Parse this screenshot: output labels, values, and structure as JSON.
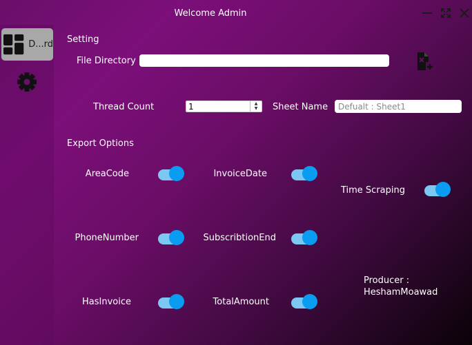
{
  "window": {
    "title": "Welcome Admin"
  },
  "sidebar": {
    "items": [
      {
        "label": "D...rd",
        "icon": "dashboard-icon",
        "active": true
      },
      {
        "label": "",
        "icon": "gear-icon",
        "active": false
      }
    ]
  },
  "settings": {
    "section_title": "Setting",
    "file_directory": {
      "label": "File Directory",
      "value": ""
    },
    "add_file_icon": "add-file-icon",
    "thread_count": {
      "label": "Thread Count",
      "value": "1"
    },
    "sheet_name": {
      "label": "Sheet Name",
      "value": "",
      "placeholder": "Defualt : Sheet1"
    }
  },
  "export": {
    "section_title": "Export Options",
    "options": [
      {
        "label": "AreaCode",
        "on": true
      },
      {
        "label": "InvoiceDate",
        "on": true
      },
      {
        "label": "Time Scraping",
        "on": true
      },
      {
        "label": "PhoneNumber",
        "on": true
      },
      {
        "label": "SubscribtionEnd",
        "on": true
      },
      {
        "label": "HasInvoice",
        "on": true
      },
      {
        "label": "TotalAmount",
        "on": true
      }
    ]
  },
  "producer": {
    "line1": "Producer :",
    "line2": "HeshamMoawad"
  },
  "colors": {
    "toggle_knob": "#0a9cf0",
    "toggle_track": "#7dc8f2",
    "nav_active": "#a8a8a8"
  }
}
